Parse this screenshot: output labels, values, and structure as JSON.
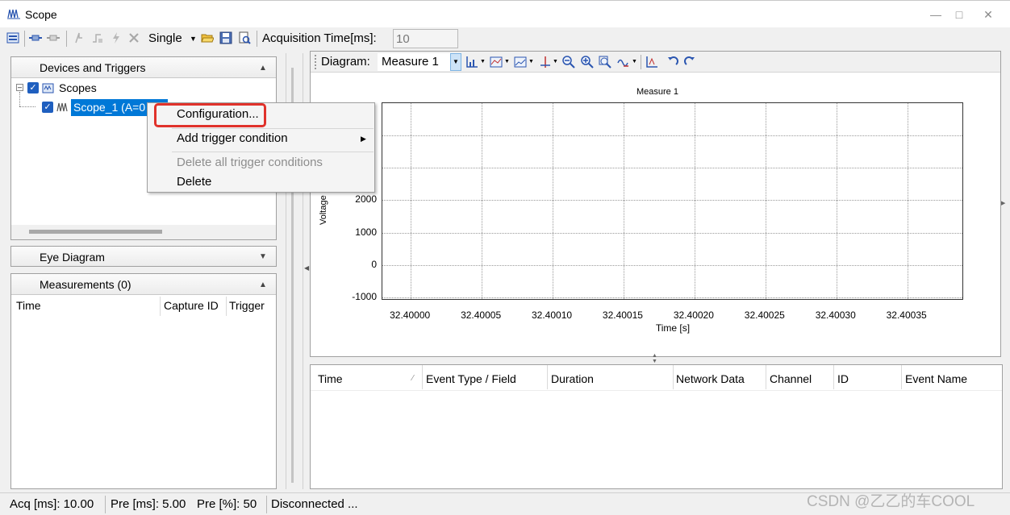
{
  "window": {
    "title": "Scope",
    "minimize_icon": "minimize-icon",
    "maximize_icon": "maximize-icon",
    "close_icon": "close-icon"
  },
  "toolbar": {
    "mode_label": "Single",
    "acquisition_label": "Acquisition Time[ms]:",
    "acquisition_value": "10"
  },
  "left_panel": {
    "devices": {
      "header": "Devices and Triggers",
      "tree": {
        "root_label": "Scopes",
        "child_label": "Scope_1 (A=0"
      }
    },
    "eye_diagram": {
      "header": "Eye Diagram"
    },
    "measurements": {
      "header": "Measurements (0)",
      "columns": [
        "Time",
        "Capture ID",
        "Trigger"
      ]
    }
  },
  "context_menu": {
    "items": [
      {
        "label": "Configuration...",
        "enabled": true
      },
      {
        "label": "Add trigger condition",
        "enabled": true,
        "submenu": true
      },
      {
        "label": "Delete all trigger conditions",
        "enabled": false
      },
      {
        "label": "Delete",
        "enabled": true
      }
    ]
  },
  "diagram": {
    "toolbar_label": "Diagram:",
    "selected_measure": "Measure 1"
  },
  "chart_data": {
    "type": "line",
    "title": "Measure 1",
    "xlabel": "Time [s]",
    "ylabel": "Voltage",
    "x_ticks": [
      "32.40000",
      "32.40005",
      "32.40010",
      "32.40015",
      "32.40020",
      "32.40025",
      "32.40030",
      "32.40035"
    ],
    "y_ticks": [
      "2000",
      "1000",
      "0",
      "-1000"
    ],
    "xlim": [
      32.39998,
      32.40039
    ],
    "ylim": [
      -1100,
      5000
    ],
    "grid": true,
    "series": []
  },
  "events_table": {
    "columns": [
      "Time",
      "Event Type / Field",
      "Duration",
      "Network Data",
      "Channel",
      "ID",
      "Event Name"
    ]
  },
  "status_bar": {
    "acq": "Acq [ms]: 10.00",
    "pre_ms": "Pre [ms]:  5.00",
    "pre_pct": "Pre [%]:  50",
    "connection": "Disconnected ..."
  },
  "watermark": "CSDN @乙乙的车COOL",
  "colors": {
    "selection": "#0078d7",
    "highlight_box": "#e0322b",
    "check": "#1f5fbf"
  }
}
